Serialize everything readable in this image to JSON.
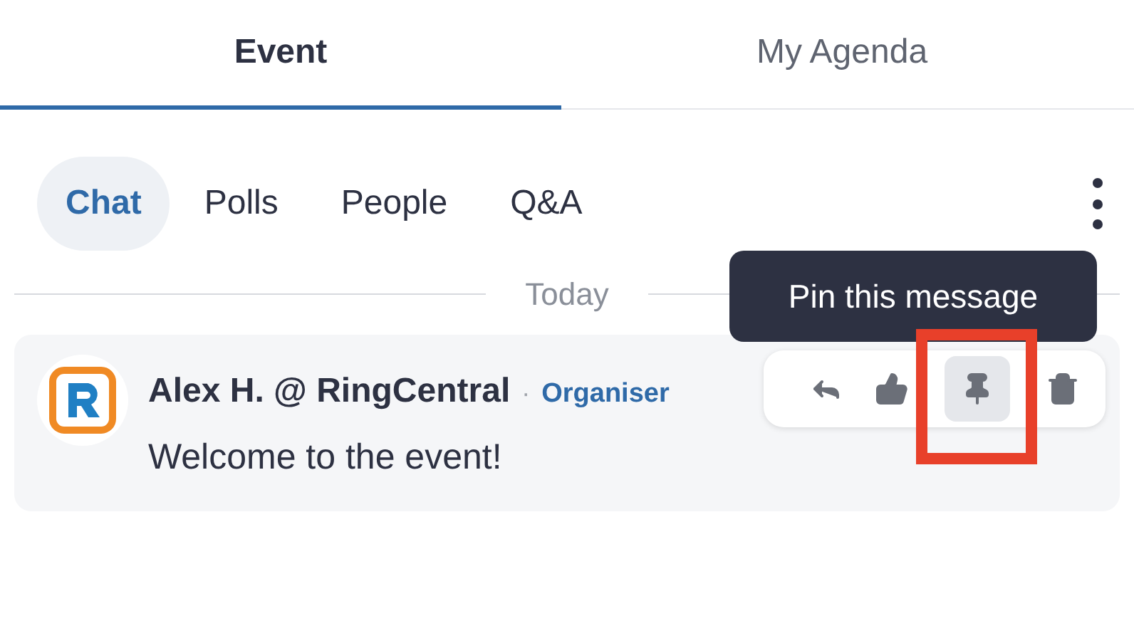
{
  "tabs": [
    {
      "label": "Event",
      "selected": true
    },
    {
      "label": "My Agenda",
      "selected": false
    }
  ],
  "subtabs": [
    {
      "label": "Chat",
      "selected": true
    },
    {
      "label": "Polls",
      "selected": false
    },
    {
      "label": "People",
      "selected": false
    },
    {
      "label": "Q&A",
      "selected": false
    }
  ],
  "divider": "Today",
  "message": {
    "author": "Alex H. @ RingCentral",
    "separator": "·",
    "role": "Organiser",
    "text": "Welcome to the event!"
  },
  "tooltip": "Pin this message",
  "actions": [
    {
      "kind": "reply",
      "selected": false
    },
    {
      "kind": "like",
      "selected": false
    },
    {
      "kind": "pin",
      "selected": true
    },
    {
      "kind": "delete",
      "selected": false
    }
  ]
}
